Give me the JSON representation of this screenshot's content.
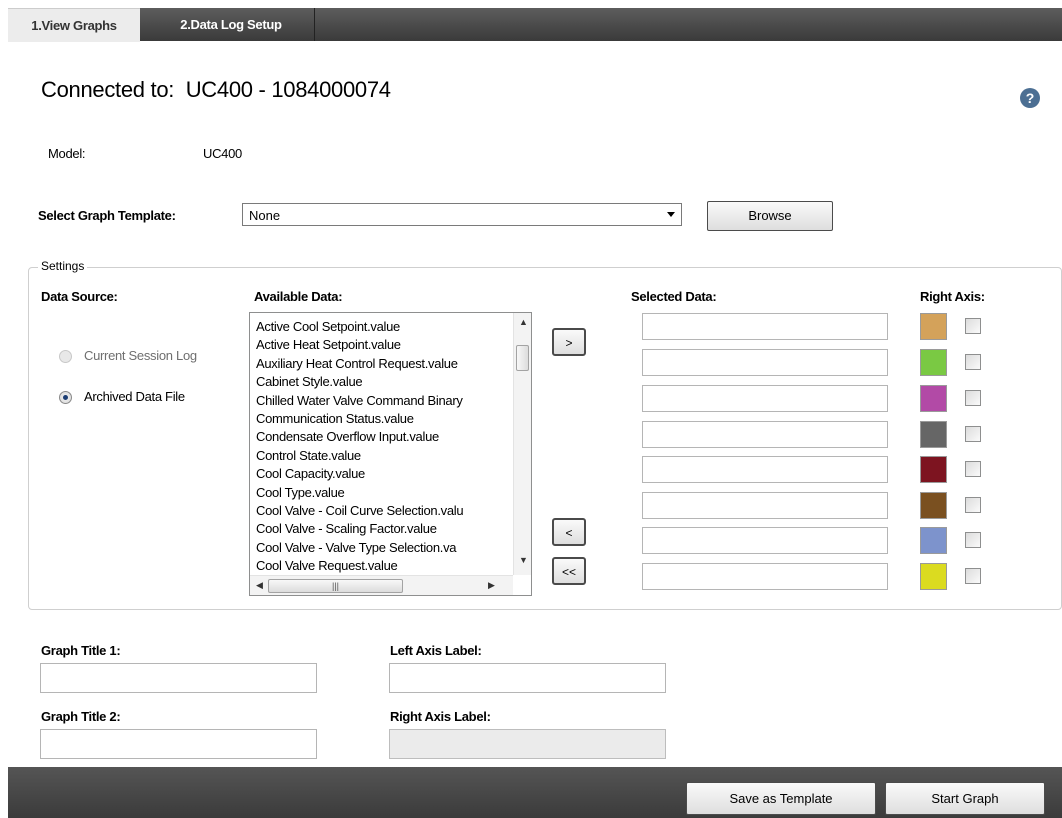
{
  "tabs": [
    {
      "label": "1.View Graphs"
    },
    {
      "label": "2.Data Log Setup"
    }
  ],
  "header": {
    "connected_label": "Connected to:",
    "device": "UC400 - 1084000074",
    "help_icon": "help-icon"
  },
  "model": {
    "label": "Model:",
    "value": "UC400"
  },
  "template": {
    "label": "Select Graph Template:",
    "selected": "None",
    "browse_label": "Browse"
  },
  "settings": {
    "legend": "Settings",
    "data_source_label": "Data Source:",
    "sources": [
      {
        "label": "Current Session Log",
        "selected": false,
        "enabled": false
      },
      {
        "label": "Archived Data File",
        "selected": true,
        "enabled": true
      }
    ],
    "available_label": "Available Data:",
    "available_items": [
      "Active Cool Setpoint.value",
      "Active Heat Setpoint.value",
      "Auxiliary Heat Control Request.value",
      "Cabinet Style.value",
      "Chilled Water Valve Command Binary",
      "Communication Status.value",
      "Condensate Overflow Input.value",
      "Control State.value",
      "Cool Capacity.value",
      "Cool Type.value",
      "Cool Valve - Coil Curve Selection.valu",
      "Cool Valve - Scaling Factor.value",
      "Cool Valve - Valve Type Selection.va",
      "Cool Valve Request.value"
    ],
    "add_label": ">",
    "remove_label": "<",
    "remove_all_label": "<<",
    "selected_label": "Selected Data:",
    "selected_items": [
      "",
      "",
      "",
      "",
      "",
      "",
      "",
      ""
    ],
    "right_axis_label": "Right Axis:",
    "series_colors": [
      "#d4a25a",
      "#7ac943",
      "#b24aa6",
      "#666666",
      "#7d1420",
      "#7a5020",
      "#7d93cc",
      "#dbdb20"
    ],
    "right_axis_checked": [
      false,
      false,
      false,
      false,
      false,
      false,
      false,
      false
    ]
  },
  "labels": {
    "graph_title_1": "Graph Title 1:",
    "graph_title_2": "Graph Title 2:",
    "left_axis": "Left Axis Label:",
    "right_axis": "Right Axis Label:"
  },
  "fields": {
    "graph_title_1": "",
    "graph_title_2": "",
    "left_axis": "",
    "right_axis": ""
  },
  "footer": {
    "save_template_label": "Save as Template",
    "start_graph_label": "Start Graph"
  }
}
